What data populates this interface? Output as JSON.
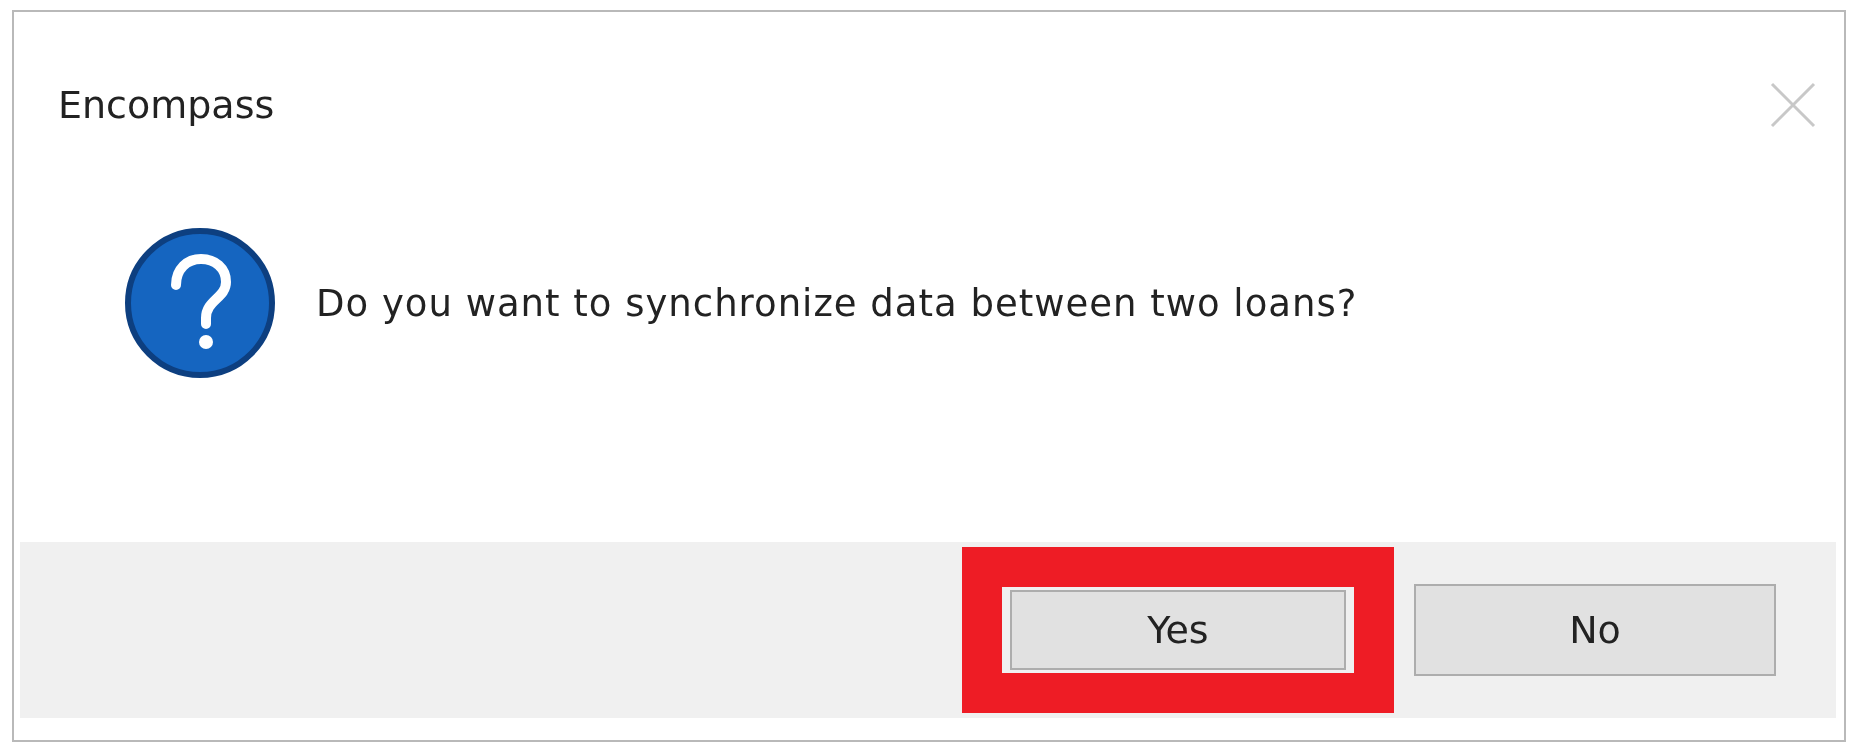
{
  "window": {
    "title": "Encompass"
  },
  "message": "Do you want to synchronize data between two loans?",
  "buttons": [
    {
      "label": "Yes",
      "highlighted": true
    },
    {
      "label": "No",
      "highlighted": false
    }
  ]
}
